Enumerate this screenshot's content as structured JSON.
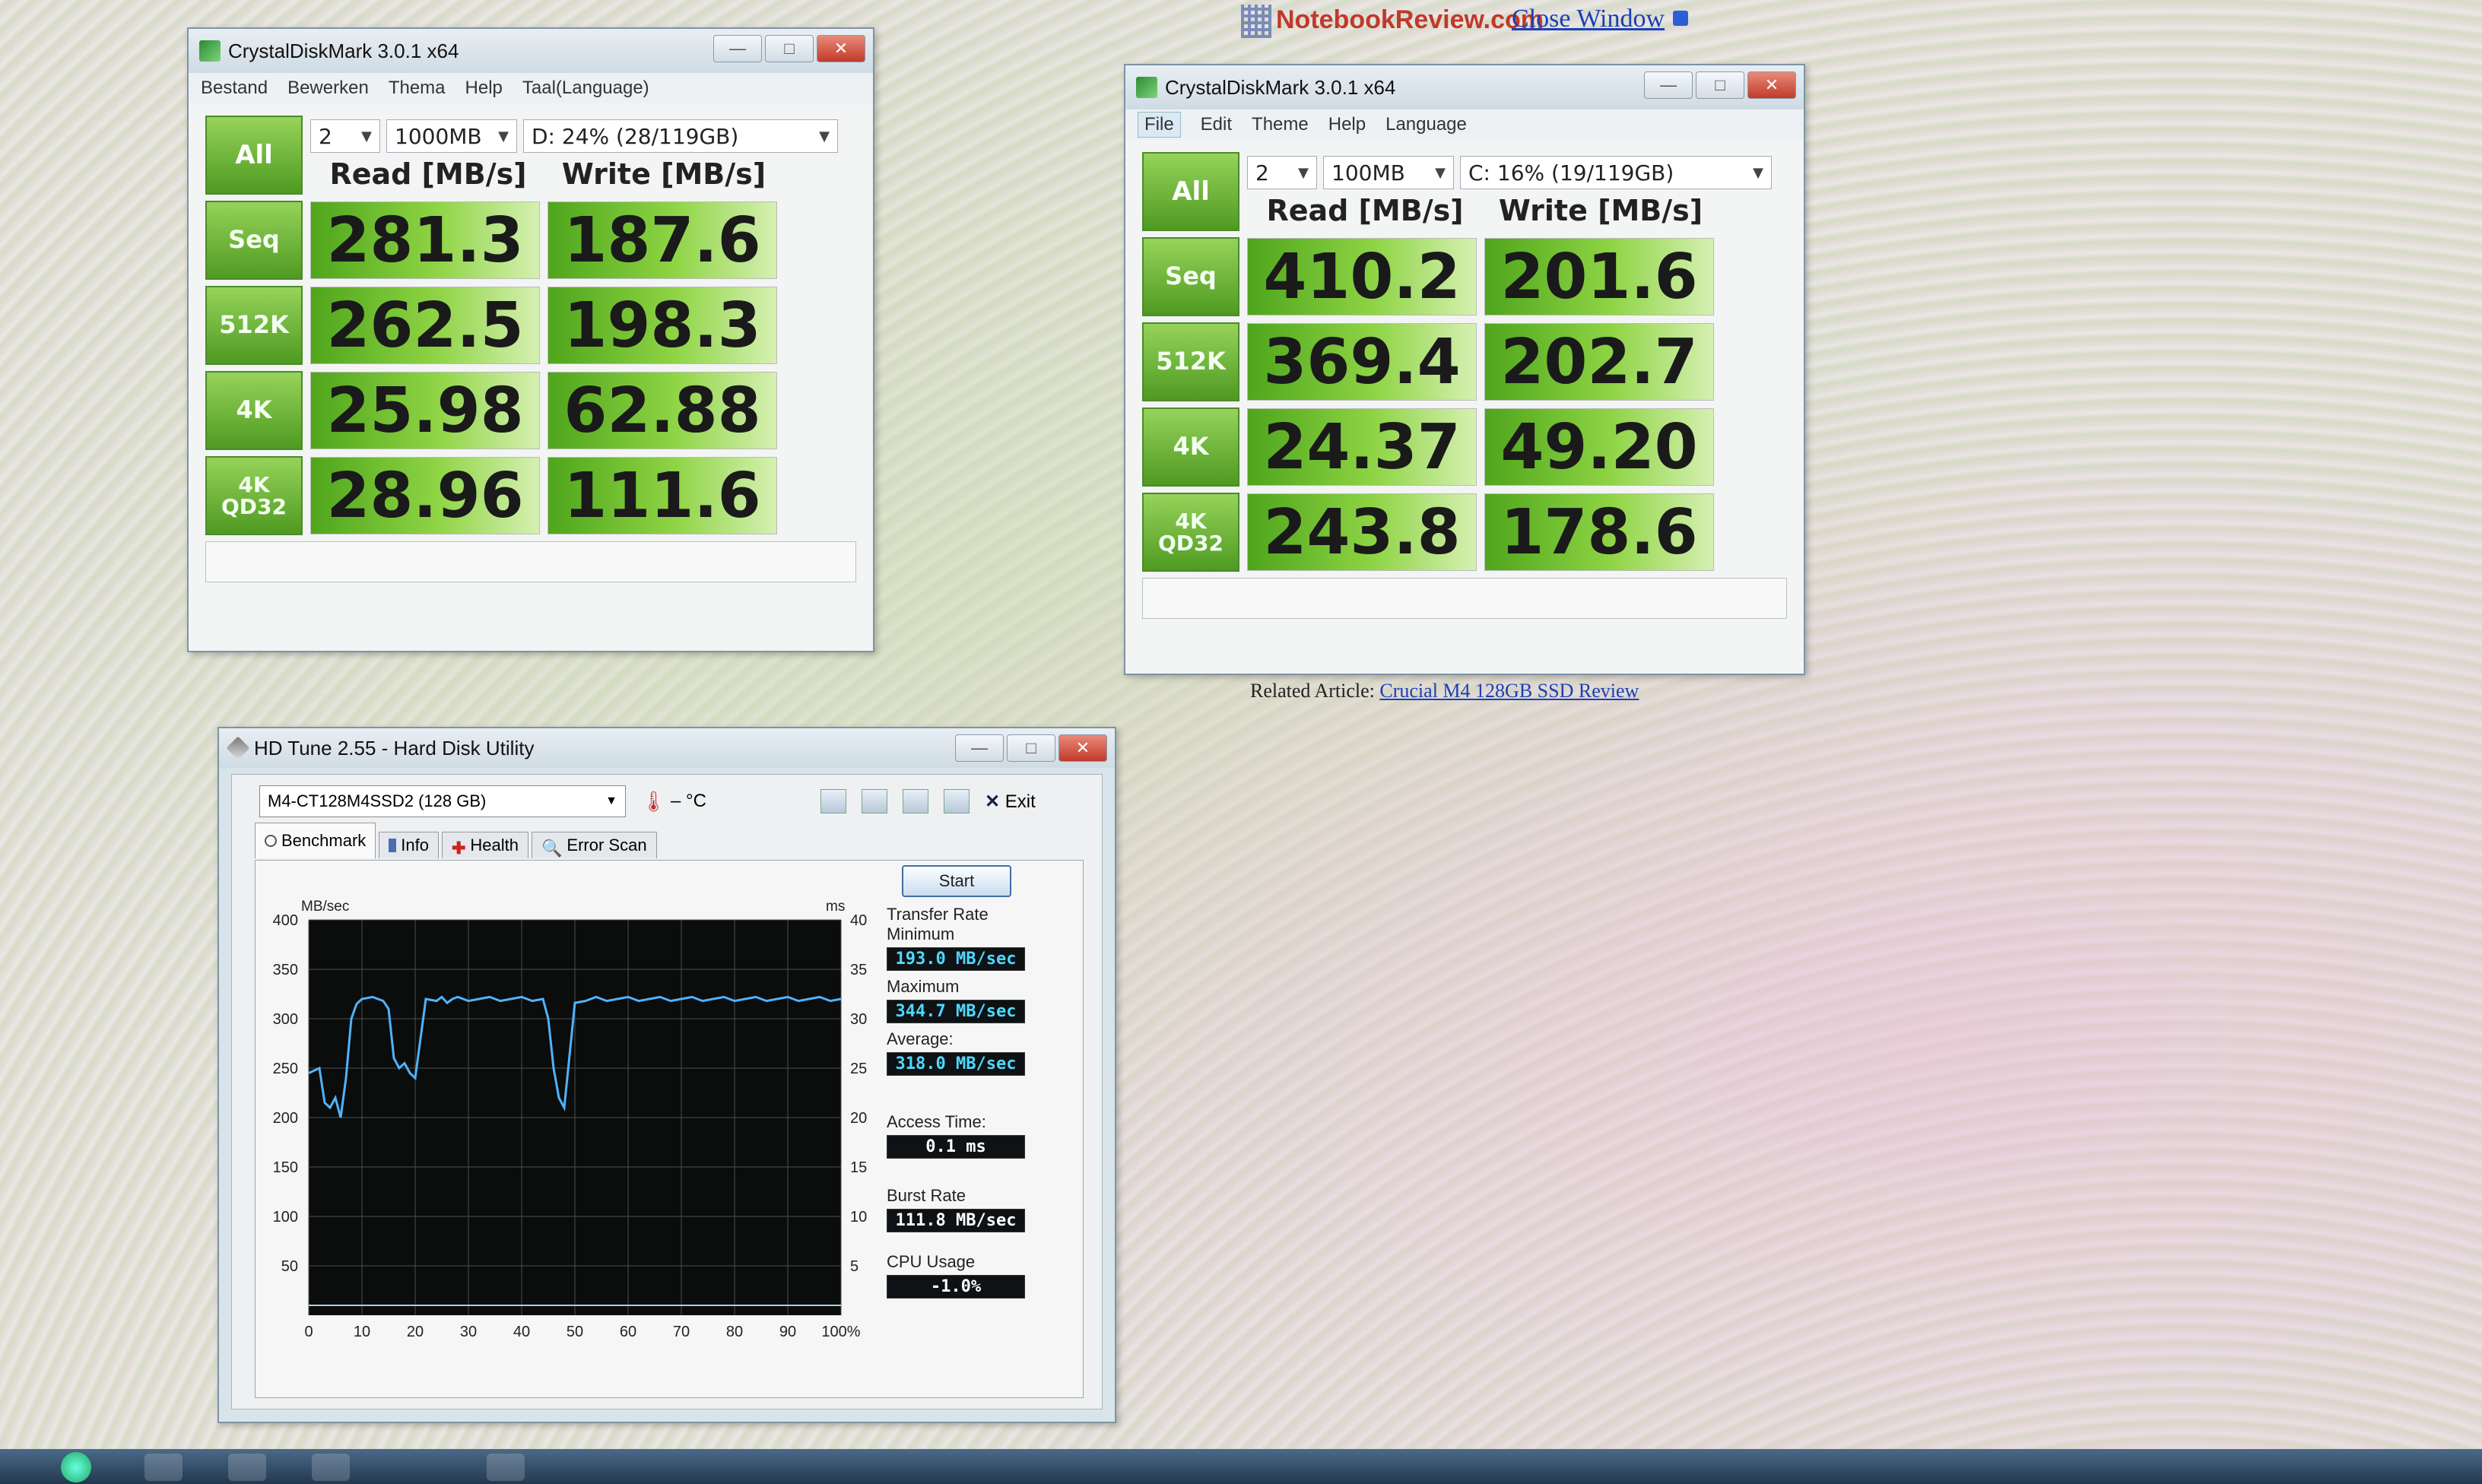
{
  "page": {
    "site_logo": "NotebookReview.com",
    "close_window": "Close Window",
    "related_label": "Related Article:",
    "related_link": "Crucial M4 128GB SSD Review"
  },
  "cdm_left": {
    "title": "CrystalDiskMark 3.0.1 x64",
    "menu": [
      "Bestand",
      "Bewerken",
      "Thema",
      "Help",
      "Taal(Language)"
    ],
    "all_label": "All",
    "count": "2",
    "size": "1000MB",
    "drive": "D: 24% (28/119GB)",
    "read_header": "Read [MB/s]",
    "write_header": "Write [MB/s]",
    "rows": [
      {
        "label": "Seq",
        "read": "281.3",
        "write": "187.6"
      },
      {
        "label": "512K",
        "read": "262.5",
        "write": "198.3"
      },
      {
        "label": "4K",
        "read": "25.98",
        "write": "62.88"
      },
      {
        "label": "4K\nQD32",
        "read": "28.96",
        "write": "111.6"
      }
    ]
  },
  "cdm_right": {
    "title": "CrystalDiskMark 3.0.1 x64",
    "menu": [
      "File",
      "Edit",
      "Theme",
      "Help",
      "Language"
    ],
    "all_label": "All",
    "count": "2",
    "size": "100MB",
    "drive": "C: 16% (19/119GB)",
    "read_header": "Read [MB/s]",
    "write_header": "Write [MB/s]",
    "rows": [
      {
        "label": "Seq",
        "read": "410.2",
        "write": "201.6"
      },
      {
        "label": "512K",
        "read": "369.4",
        "write": "202.7"
      },
      {
        "label": "4K",
        "read": "24.37",
        "write": "49.20"
      },
      {
        "label": "4K\nQD32",
        "read": "243.8",
        "write": "178.6"
      }
    ]
  },
  "hdtune": {
    "title": "HD Tune 2.55 - Hard Disk Utility",
    "drive": "M4-CT128M4SSD2 (128 GB)",
    "temp": "– °C",
    "exit_label": "Exit",
    "tabs": [
      "Benchmark",
      "Info",
      "Health",
      "Error Scan"
    ],
    "start_label": "Start",
    "transfer_rate_label": "Transfer Rate",
    "minimum_label": "Minimum",
    "minimum_value": "193.0 MB/sec",
    "maximum_label": "Maximum",
    "maximum_value": "344.7 MB/sec",
    "average_label": "Average:",
    "average_value": "318.0 MB/sec",
    "access_label": "Access Time:",
    "access_value": "0.1 ms",
    "burst_label": "Burst Rate",
    "burst_value": "111.8 MB/sec",
    "cpu_label": "CPU Usage",
    "cpu_value": "-1.0%"
  },
  "chart_data": {
    "type": "line",
    "ylabel": "MB/sec",
    "y2label": "ms",
    "ylim": [
      0,
      400
    ],
    "y2lim": [
      0,
      40
    ],
    "yticks": [
      50,
      100,
      150,
      200,
      250,
      300,
      350,
      400
    ],
    "y2ticks": [
      5,
      10,
      15,
      20,
      25,
      30,
      35,
      40
    ],
    "xticks": [
      "0",
      "10",
      "20",
      "30",
      "40",
      "50",
      "60",
      "70",
      "80",
      "90",
      "100%"
    ],
    "grid": true,
    "series": [
      {
        "color": "#4fb3ff",
        "x": [
          0,
          2,
          3,
          4,
          5,
          6,
          7,
          8,
          9,
          10,
          12,
          14,
          15,
          16,
          17,
          18,
          19,
          20,
          22,
          24,
          25,
          26,
          27,
          28,
          30,
          32,
          34,
          36,
          38,
          40,
          42,
          44,
          45,
          46,
          47,
          48,
          50,
          52,
          54,
          56,
          58,
          60,
          62,
          64,
          66,
          68,
          70,
          72,
          74,
          76,
          78,
          80,
          82,
          84,
          86,
          88,
          90,
          92,
          94,
          96,
          98,
          100
        ],
        "values": [
          245,
          250,
          215,
          210,
          220,
          200,
          240,
          300,
          315,
          320,
          322,
          318,
          310,
          260,
          250,
          255,
          245,
          240,
          320,
          318,
          322,
          316,
          320,
          322,
          318,
          320,
          322,
          318,
          320,
          322,
          318,
          320,
          300,
          250,
          220,
          210,
          316,
          318,
          322,
          318,
          320,
          322,
          318,
          320,
          322,
          318,
          320,
          322,
          318,
          320,
          322,
          318,
          320,
          322,
          318,
          320,
          322,
          318,
          320,
          322,
          318,
          320
        ]
      },
      {
        "color": "#a9cfe0",
        "values": [
          1,
          1,
          1,
          1,
          1,
          1,
          1,
          1,
          1,
          1,
          1
        ]
      }
    ]
  }
}
